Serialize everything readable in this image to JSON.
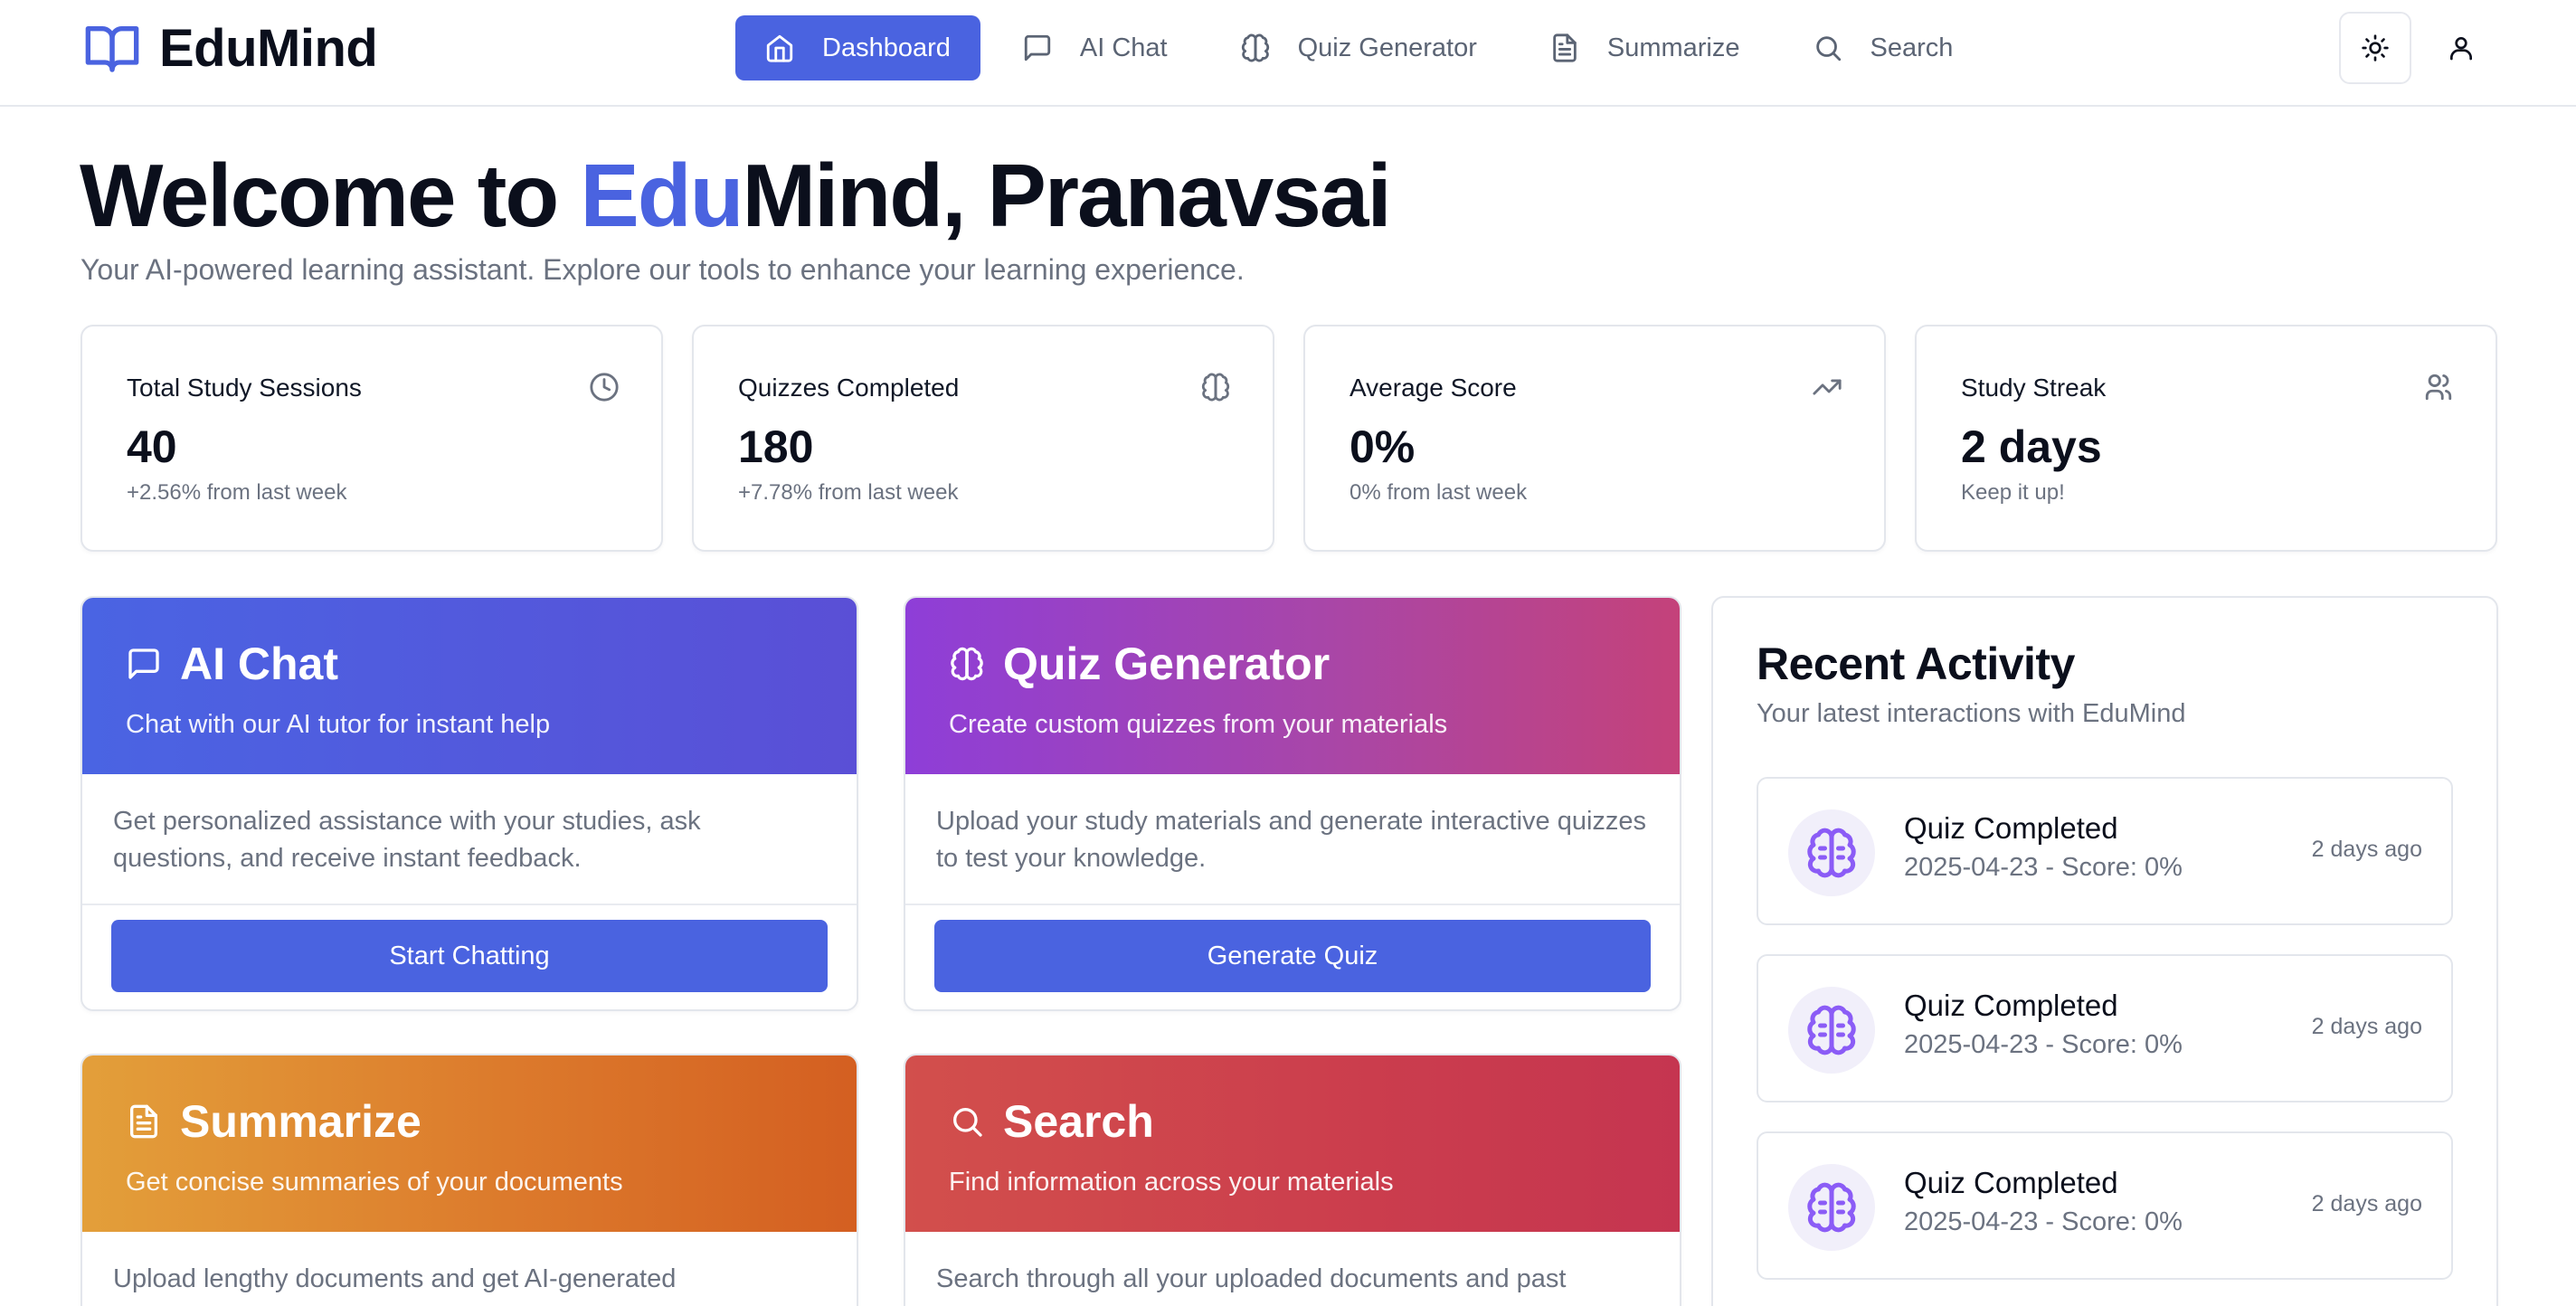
{
  "brand": {
    "name": "EduMind"
  },
  "nav": {
    "items": [
      {
        "label": "Dashboard",
        "icon": "home-icon",
        "active": true
      },
      {
        "label": "AI Chat",
        "icon": "message-square-icon",
        "active": false
      },
      {
        "label": "Quiz Generator",
        "icon": "brain-icon",
        "active": false
      },
      {
        "label": "Summarize",
        "icon": "file-text-icon",
        "active": false
      },
      {
        "label": "Search",
        "icon": "search-icon",
        "active": false
      }
    ],
    "theme_icon": "sun-icon",
    "user_icon": "user-icon"
  },
  "welcome": {
    "prefix": "Welcome to ",
    "accent": "Edu",
    "suffix": "Mind, Pranavsai",
    "subtitle": "Your AI-powered learning assistant. Explore our tools to enhance your learning experience."
  },
  "stats": [
    {
      "label": "Total Study Sessions",
      "value": "40",
      "sub": "+2.56% from last week",
      "icon": "clock-icon"
    },
    {
      "label": "Quizzes Completed",
      "value": "180",
      "sub": "+7.78% from last week",
      "icon": "brain-icon"
    },
    {
      "label": "Average Score",
      "value": "0%",
      "sub": "0% from last week",
      "icon": "trending-up-icon"
    },
    {
      "label": "Study Streak",
      "value": "2 days",
      "sub": "Keep it up!",
      "icon": "users-icon"
    }
  ],
  "features": [
    {
      "title": "AI Chat",
      "subtitle": "Chat with our AI tutor for instant help",
      "description": "Get personalized assistance with your studies, ask questions, and receive instant feedback.",
      "button": "Start Chatting",
      "icon": "message-square-icon",
      "color": "#4a64e3"
    },
    {
      "title": "Quiz Generator",
      "subtitle": "Create custom quizzes from your materials",
      "description": "Upload your study materials and generate interactive quizzes to test your knowledge.",
      "button": "Generate Quiz",
      "icon": "brain-icon",
      "color": "#a946a7"
    },
    {
      "title": "Summarize",
      "subtitle": "Get concise summaries of your documents",
      "description": "Upload lengthy documents and get AI-generated",
      "icon": "file-text-icon",
      "color": "#dc7a2c"
    },
    {
      "title": "Search",
      "subtitle": "Find information across your materials",
      "description": "Search through all your uploaded documents and past",
      "icon": "search-icon",
      "color": "#cb3d4d"
    }
  ],
  "activity": {
    "title": "Recent Activity",
    "subtitle": "Your latest interactions with EduMind",
    "items": [
      {
        "title": "Quiz Completed",
        "detail": "2025-04-23 - Score: 0%",
        "time": "2 days ago",
        "icon": "brain-icon"
      },
      {
        "title": "Quiz Completed",
        "detail": "2025-04-23 - Score: 0%",
        "time": "2 days ago",
        "icon": "brain-icon"
      },
      {
        "title": "Quiz Completed",
        "detail": "2025-04-23 - Score: 0%",
        "time": "2 days ago",
        "icon": "brain-icon"
      }
    ]
  },
  "colors": {
    "accent": "#4a63e0",
    "muted_text": "#6b7280",
    "activity_icon": "#8b5cf6"
  }
}
